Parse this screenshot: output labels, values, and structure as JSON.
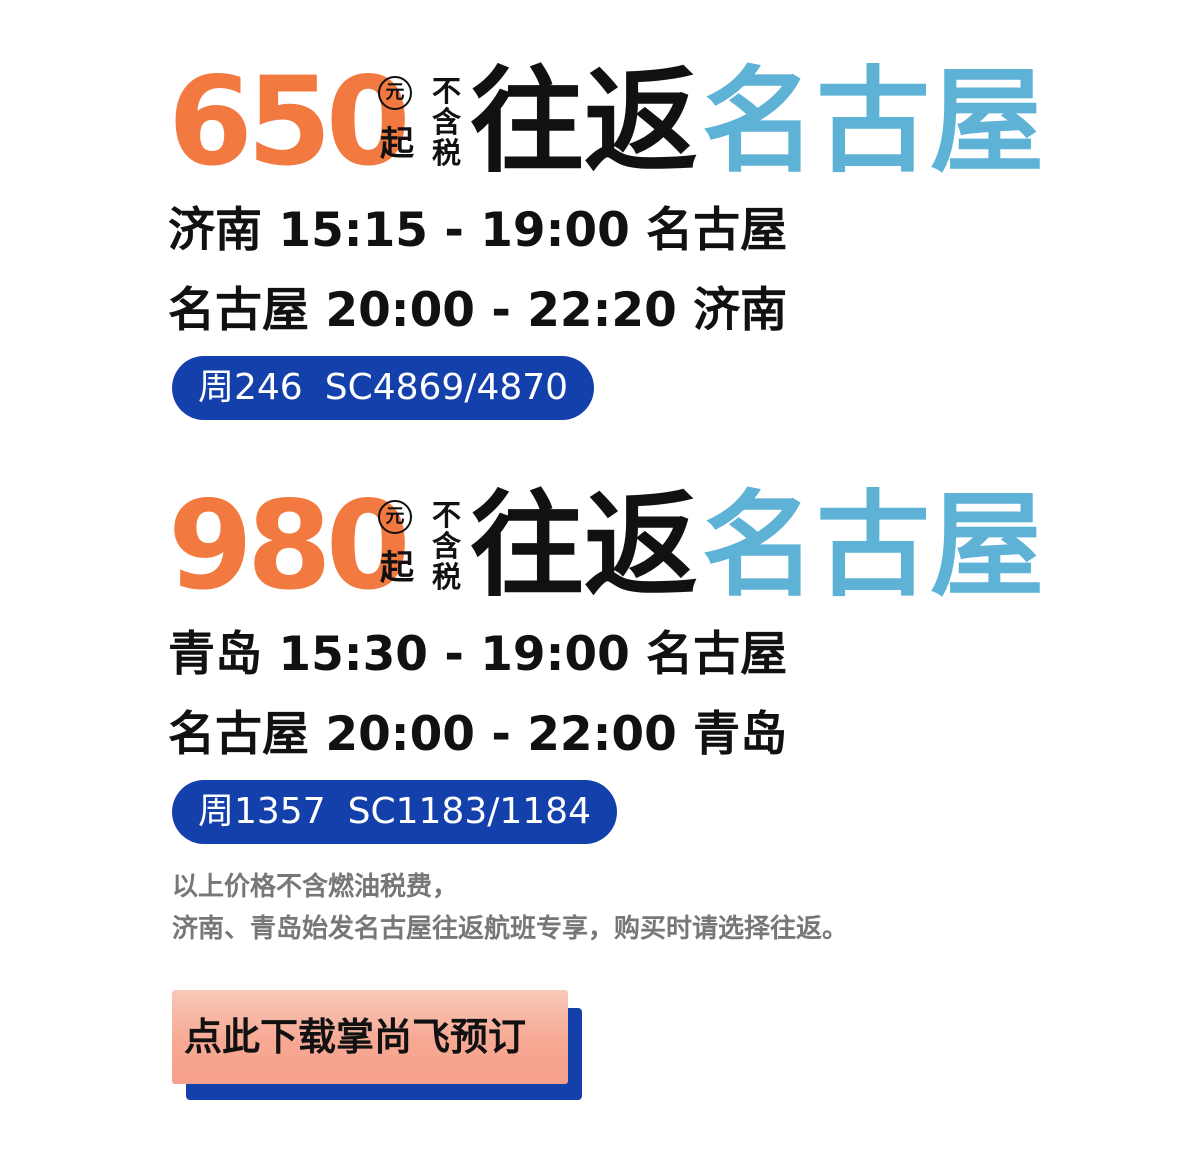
{
  "offers": [
    {
      "price": "650",
      "currency": "元",
      "from": "起",
      "tax_note": "不含税",
      "round_trip": "往返",
      "destination": "名古屋",
      "outbound": "济南 15:15 - 19:00 名古屋",
      "return": "名古屋 20:00 - 22:20 济南",
      "days": "周246",
      "flights": "SC4869/4870"
    },
    {
      "price": "980",
      "currency": "元",
      "from": "起",
      "tax_note": "不含税",
      "round_trip": "往返",
      "destination": "名古屋",
      "outbound": "青岛 15:30 - 19:00 名古屋",
      "return": "名古屋 20:00 - 22:00 青岛",
      "days": "周1357",
      "flights": "SC1183/1184"
    }
  ],
  "notes": {
    "line1": "以上价格不含燃油税费，",
    "line2": "济南、青岛始发名古屋往返航班专享，购买时请选择往返。"
  },
  "cta": {
    "label": "点此下载掌尚飞预订"
  },
  "colors": {
    "price": "#f2793f",
    "destination": "#5db2d6",
    "pill": "#1340aa",
    "cta_fill": "#f7a893",
    "notes": "#777777"
  }
}
